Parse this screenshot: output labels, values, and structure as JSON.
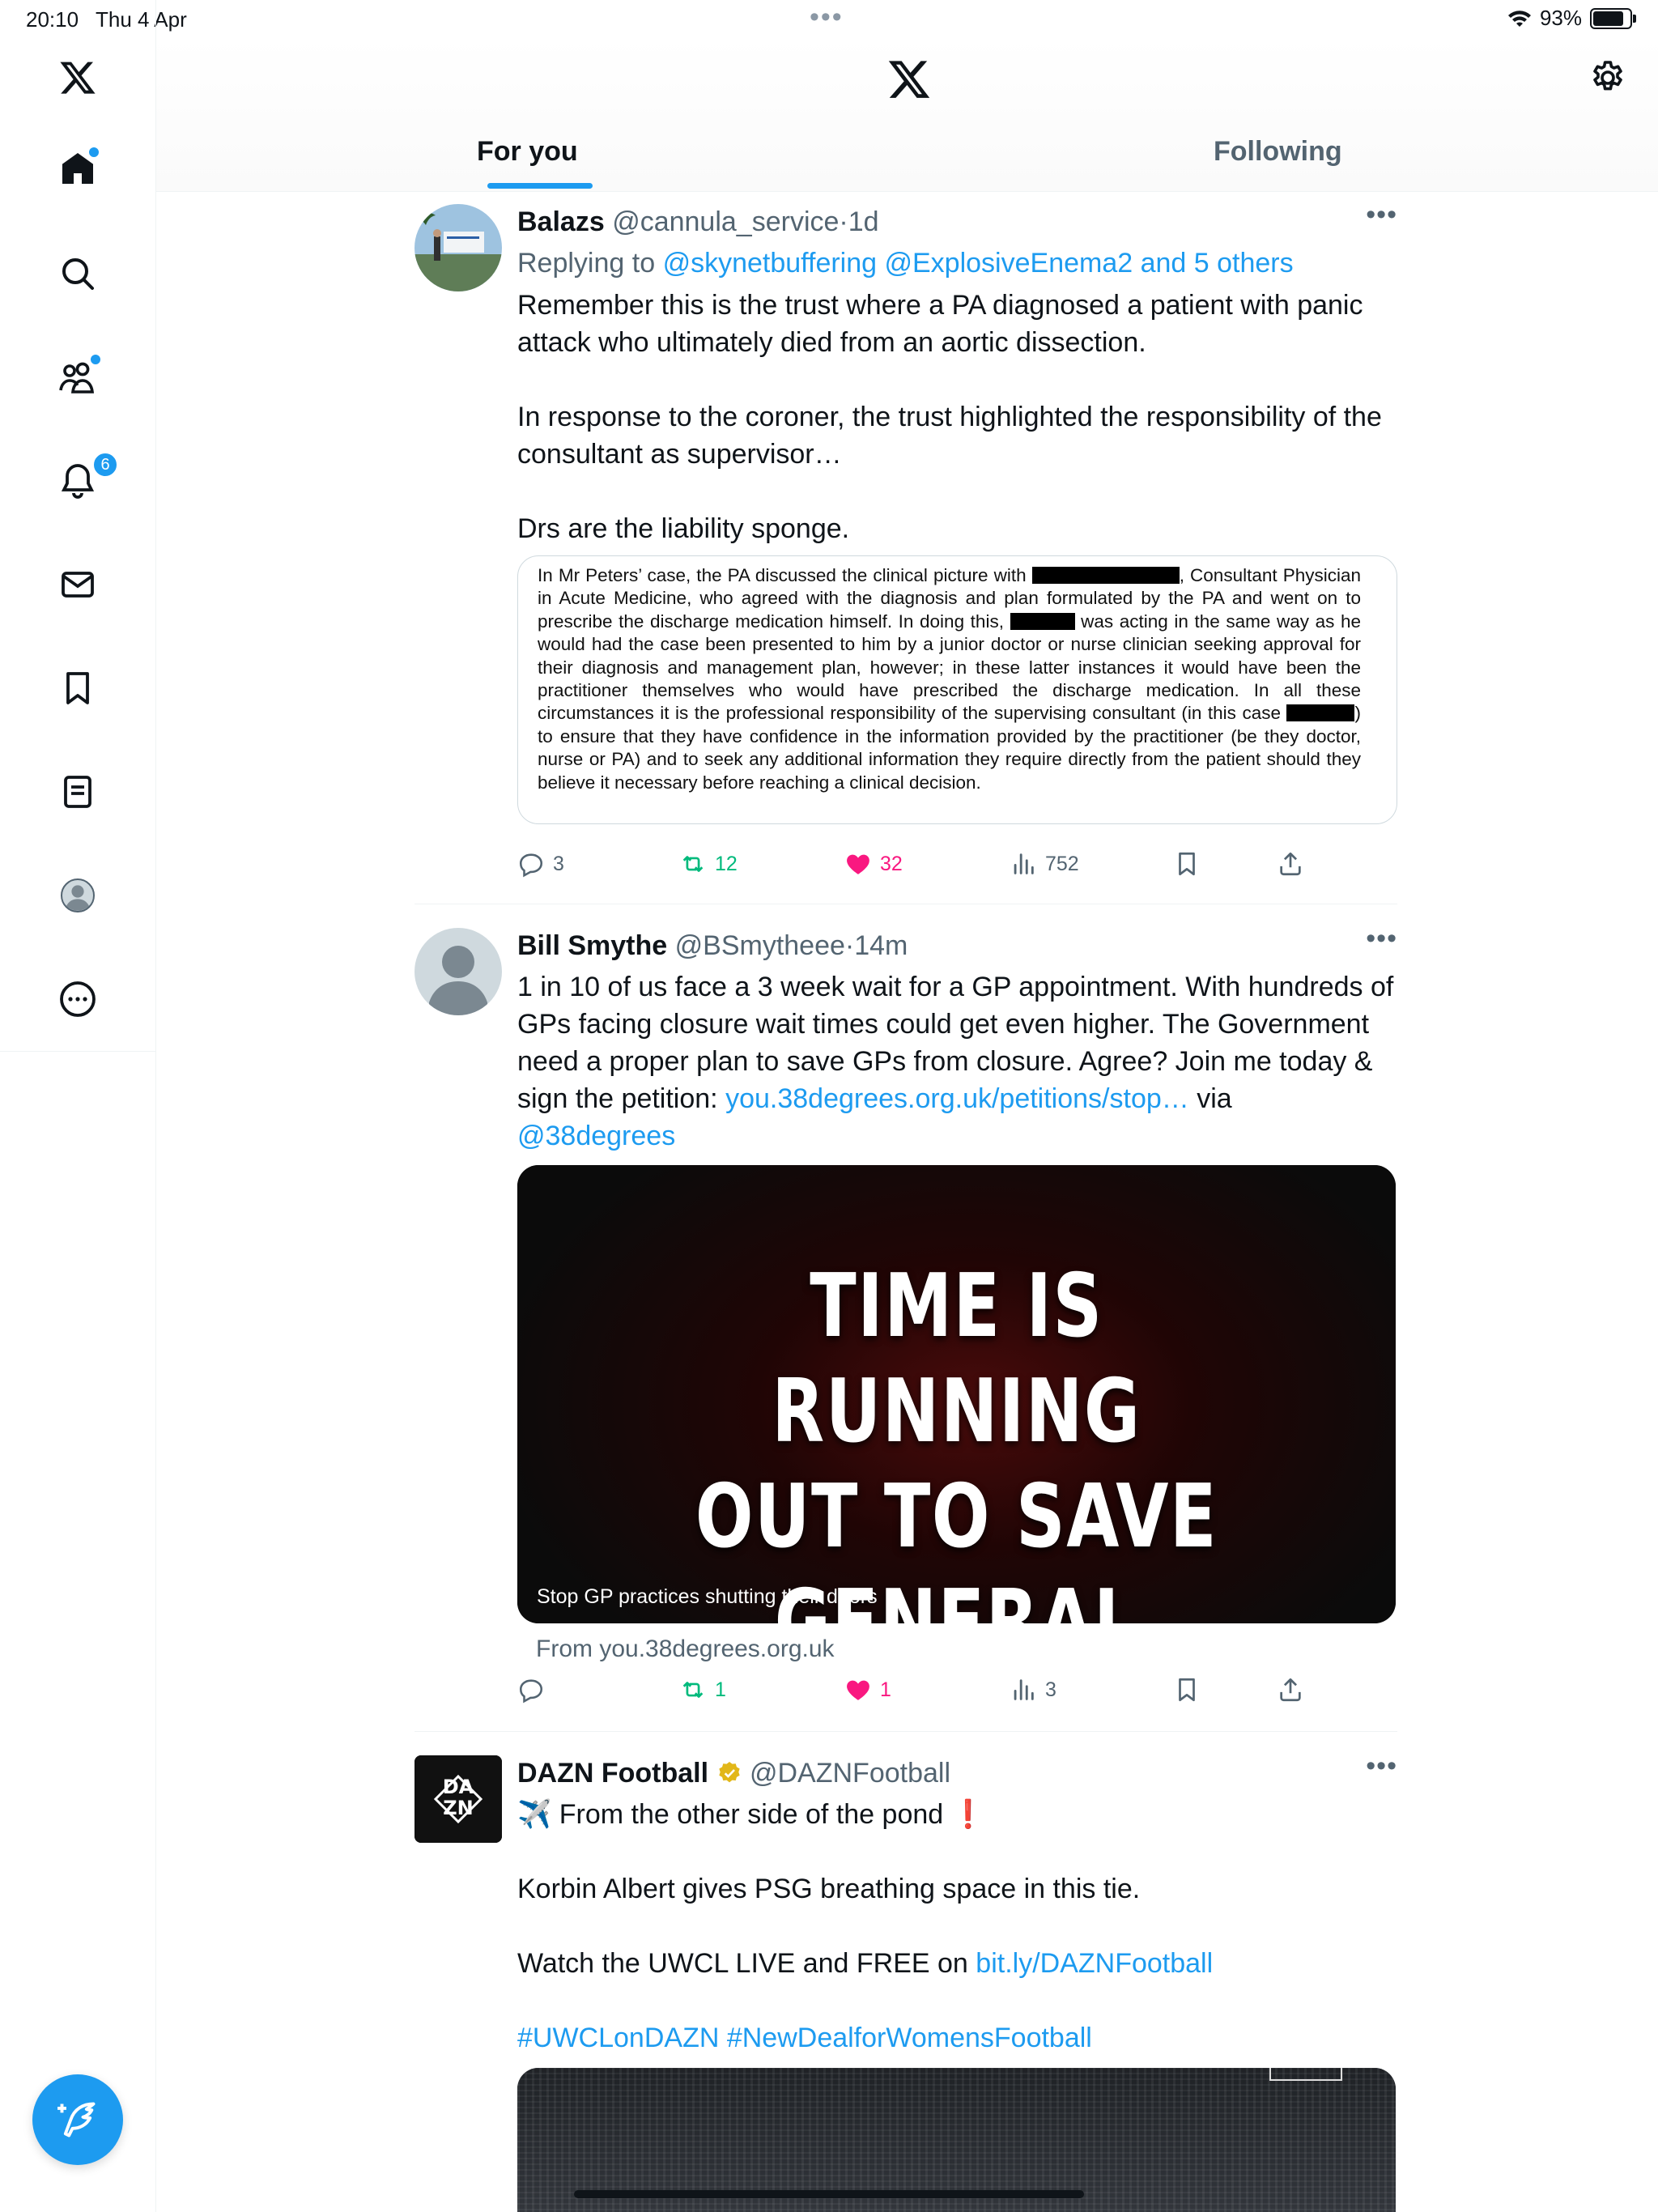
{
  "status_bar": {
    "time": "20:10",
    "date": "Thu 4 Apr",
    "battery": "93%",
    "battery_level": 0.93
  },
  "header": {
    "tabs": [
      {
        "label": "For you",
        "active": true
      },
      {
        "label": "Following",
        "active": false
      }
    ]
  },
  "sidebar": {
    "items": [
      "x-logo",
      "home-icon",
      "search-icon",
      "communities-icon",
      "notifications-icon",
      "messages-icon",
      "bookmarks-icon",
      "lists-icon",
      "profile-icon",
      "more-icon"
    ],
    "notifications_count": "6"
  },
  "colors": {
    "accent": "#1d9bf0",
    "like": "#f91880",
    "retweet": "#00ba7c",
    "text": "#0f1419",
    "muted": "#536471"
  },
  "tweets": [
    {
      "name": "Balazs",
      "handle": "@cannula_service",
      "sep": "·",
      "time": "1d",
      "replying_prefix": "Replying to",
      "replying_to": "@skynetbuffering @ExplosiveEnema2 and 5 others",
      "paragraphs": [
        "Remember this is the trust where a PA diagnosed a patient with panic attack who ultimately died from an aortic dissection.",
        "In response to the coroner, the trust highlighted the responsibility of the consultant as supervisor…",
        "Drs are the liability sponge."
      ],
      "document": {
        "s1": "In Mr Peters’ case, the PA discussed the clinical picture with",
        "s2": ", Consultant Physician in Acute Medicine, who agreed with the diagnosis and plan formulated by the PA and went on to prescribe the discharge medication himself.  In doing this,",
        "s3": "was acting in the same way as he would had the case been presented to him by a junior doctor or nurse clinician seeking approval for their diagnosis and management plan, however; in these latter instances it would have been the practitioner themselves who would have prescribed the discharge medication.  In all these circumstances it is the professional responsibility of the supervising consultant (in this case",
        "s4": ") to ensure that they have confidence in the information provided by the practitioner (be they doctor, nurse or PA) and to seek any additional information they require directly from the patient should they believe it necessary before reaching a clinical decision."
      },
      "stats": {
        "replies": "3",
        "retweets": "12",
        "likes": "32",
        "views": "752"
      }
    },
    {
      "name": "Bill Smythe",
      "handle": "@BSmytheee",
      "sep": "·",
      "time": "14m",
      "text_before_link": "1 in 10 of us face a 3 week wait for a GP appointment. With hundreds of GPs facing closure wait times could get even higher. The Government need a proper plan to save GPs from closure. Agree? Join me today & sign the petition:",
      "link": "you.38degrees.org.uk/petitions/stop…",
      "text_via": "via",
      "mention": "@38degrees",
      "card": {
        "headline_lines": [
          "TIME IS RUNNING",
          "OUT TO SAVE",
          "GENERAL PRACTICE"
        ],
        "caption": "Stop GP practices shutting their doors",
        "source": "From you.38degrees.org.uk"
      },
      "stats": {
        "replies": "",
        "retweets": "1",
        "likes": "1",
        "views": "3"
      }
    },
    {
      "name": "DAZN Football",
      "verified": true,
      "handle": "@DAZNFootball",
      "avatar_text": [
        "DA",
        "ZN"
      ],
      "line1": "✈️ From the other side of the pond ❗",
      "line2": "Korbin Albert gives PSG breathing space in this tie.",
      "line3_prefix": "Watch the UWCL LIVE and FREE on",
      "line3_link": "bit.ly/DAZNFootball",
      "hashtags": "#UWCLonDAZN #NewDealforWomensFootball"
    }
  ]
}
